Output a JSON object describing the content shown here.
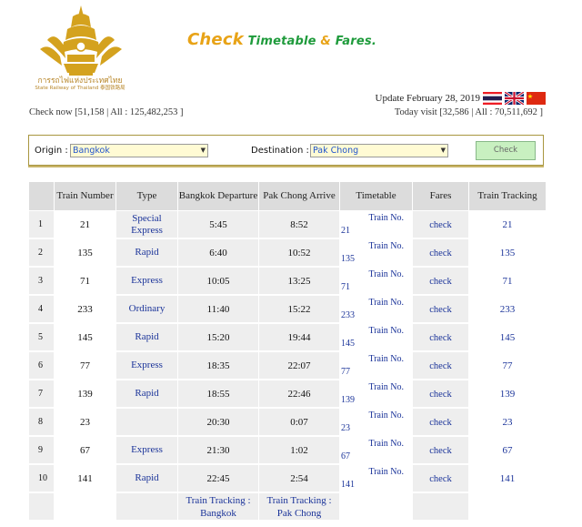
{
  "branding": {
    "logo_text_th": "การรถไฟแห่งประเทศไทย",
    "logo_text_en": "State Railway of Thailand 泰国铁路局",
    "headline_check": "Check",
    "headline_timetable": "Timetable",
    "headline_amp": "&",
    "headline_fares": "Fares."
  },
  "info": {
    "update": "Update February 28, 2019",
    "check_now": "Check now [51,158 | All : 125,482,253 ]",
    "today_visit": "Today visit [32,586 | All : 70,511,692 ]"
  },
  "search": {
    "origin_label": "Origin :",
    "origin_value": "Bangkok",
    "destination_label": "Destination :",
    "destination_value": "Pak Chong",
    "check_button": "Check"
  },
  "table": {
    "headers": {
      "idx": "",
      "train_number": "Train Number",
      "type": "Type",
      "departure": "Bangkok Departure",
      "arrive": "Pak Chong Arrive",
      "timetable": "Timetable",
      "fares": "Fares",
      "tracking": "Train Tracking"
    },
    "rows": [
      {
        "idx": "1",
        "number": "21",
        "type": "Special Express",
        "dep": "5:45",
        "arr": "8:52",
        "tt_label": "Train No.",
        "tt_no": "21",
        "fare": "check",
        "track": "21"
      },
      {
        "idx": "2",
        "number": "135",
        "type": "Rapid",
        "dep": "6:40",
        "arr": "10:52",
        "tt_label": "Train No.",
        "tt_no": "135",
        "fare": "check",
        "track": "135"
      },
      {
        "idx": "3",
        "number": "71",
        "type": "Express",
        "dep": "10:05",
        "arr": "13:25",
        "tt_label": "Train No.",
        "tt_no": "71",
        "fare": "check",
        "track": "71"
      },
      {
        "idx": "4",
        "number": "233",
        "type": "Ordinary",
        "dep": "11:40",
        "arr": "15:22",
        "tt_label": "Train No.",
        "tt_no": "233",
        "fare": "check",
        "track": "233"
      },
      {
        "idx": "5",
        "number": "145",
        "type": "Rapid",
        "dep": "15:20",
        "arr": "19:44",
        "tt_label": "Train No.",
        "tt_no": "145",
        "fare": "check",
        "track": "145"
      },
      {
        "idx": "6",
        "number": "77",
        "type": "Express",
        "dep": "18:35",
        "arr": "22:07",
        "tt_label": "Train No.",
        "tt_no": "77",
        "fare": "check",
        "track": "77"
      },
      {
        "idx": "7",
        "number": "139",
        "type": "Rapid",
        "dep": "18:55",
        "arr": "22:46",
        "tt_label": "Train No.",
        "tt_no": "139",
        "fare": "check",
        "track": "139"
      },
      {
        "idx": "8",
        "number": "23",
        "type": "",
        "dep": "20:30",
        "arr": "0:07",
        "tt_label": "Train No.",
        "tt_no": "23",
        "fare": "check",
        "track": "23"
      },
      {
        "idx": "9",
        "number": "67",
        "type": "Express",
        "dep": "21:30",
        "arr": "1:02",
        "tt_label": "Train No.",
        "tt_no": "67",
        "fare": "check",
        "track": "67"
      },
      {
        "idx": "10",
        "number": "141",
        "type": "Rapid",
        "dep": "22:45",
        "arr": "2:54",
        "tt_label": "Train No.",
        "tt_no": "141",
        "fare": "check",
        "track": "141"
      }
    ],
    "footer": {
      "tracking_bangkok": "Train Tracking : Bangkok",
      "tracking_pakchong": "Train Tracking : Pak Chong"
    }
  },
  "colors": {
    "brand_gold": "#e8a317",
    "brand_green": "#1f9b3c",
    "link_blue": "#1a3399",
    "row_shade": "#eeeeee"
  },
  "icons": [
    "srt-logo-icon",
    "thai-flag-icon",
    "uk-flag-icon",
    "china-flag-icon",
    "dropdown-arrow-icon"
  ]
}
